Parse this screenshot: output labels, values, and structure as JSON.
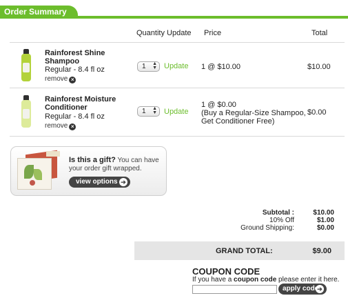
{
  "header": {
    "title": "Order Summary",
    "accent": "#6cbd2c"
  },
  "columns": {
    "quantity": "Quantity Update",
    "price": "Price",
    "total": "Total"
  },
  "items": [
    {
      "name": "Rainforest Shine Shampoo",
      "size": "Regular - 8.4 fl oz",
      "remove": "remove",
      "qty": "1",
      "update": "Update",
      "price": "1 @ $10.00",
      "total": "$10.00",
      "bottle_color": "#b3d23a"
    },
    {
      "name": "Rainforest Moisture Conditioner",
      "size": "Regular - 8.4 fl oz",
      "remove": "remove",
      "qty": "1",
      "update": "Update",
      "price_line1": "1 @ $0.00",
      "price_line2": "(Buy a Regular-Size Shampoo,",
      "price_line3": "Get Conditioner Free)",
      "total": "$0.00",
      "bottle_color": "#ddeb9a"
    }
  ],
  "gift": {
    "title": "Is this a gift?",
    "text": "You can have your order gift wrapped.",
    "button": "view options"
  },
  "summary": {
    "subtotal_label": "Subtotal :",
    "subtotal": "$10.00",
    "discount_label": "10% Off",
    "discount": "$1.00",
    "shipping_label": "Ground Shipping:",
    "shipping": "$0.00",
    "grand_label": "GRAND TOTAL:",
    "grand": "$9.00"
  },
  "coupon": {
    "title": "COUPON CODE",
    "help_prefix": "If you have a ",
    "help_bold": "coupon code",
    "help_suffix": " please enter it here.",
    "input_value": "",
    "button": "apply code"
  },
  "icons": {
    "remove": "close-circle-icon",
    "arrow": "arrow-right-circle-icon",
    "stepper": "up-down-arrows-icon"
  }
}
